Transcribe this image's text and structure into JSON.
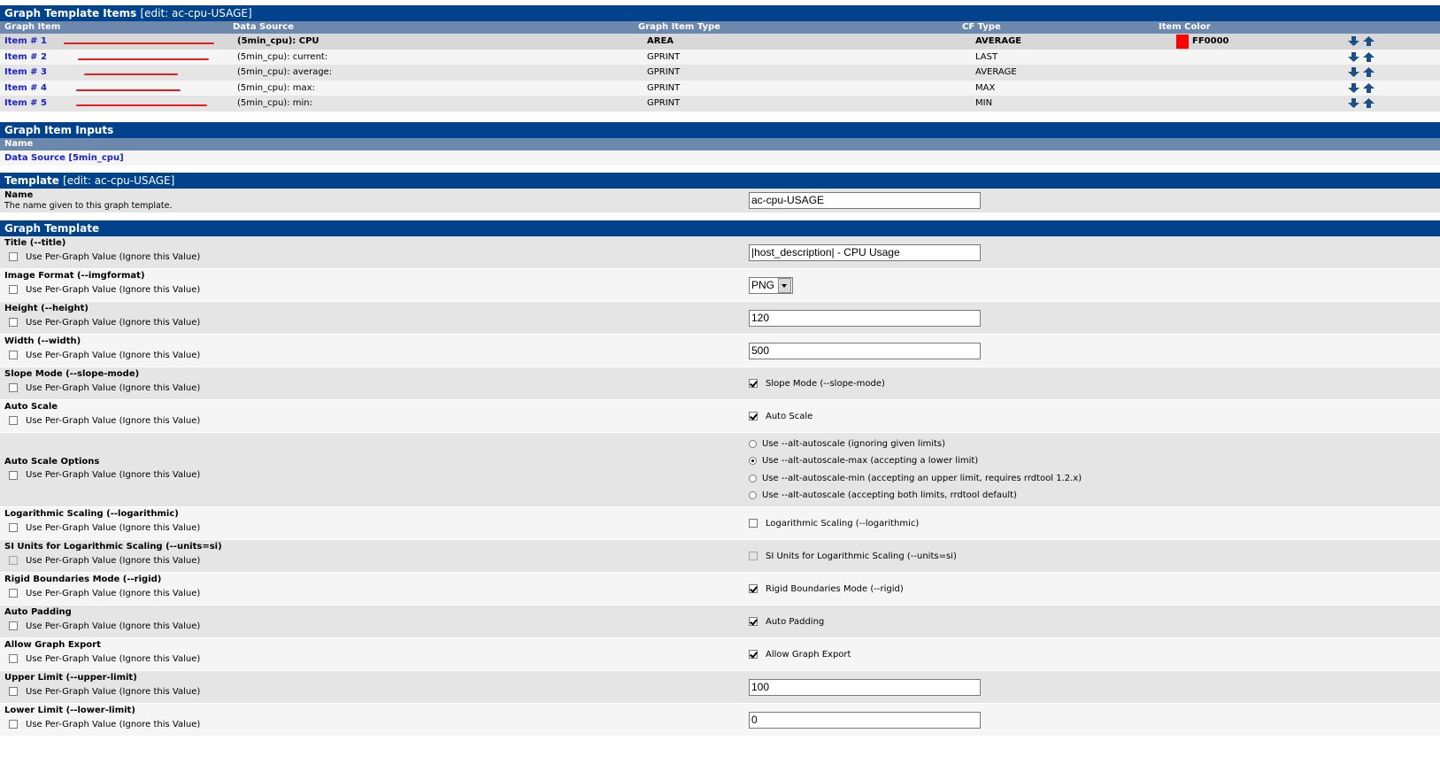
{
  "items_section": {
    "title": "Graph Template Items",
    "edit": "[edit: ac-cpu-USAGE]",
    "columns": [
      "Graph Item",
      "Data Source",
      "Graph Item Type",
      "CF Type",
      "Item Color"
    ],
    "rows": [
      {
        "item": "Item # 1",
        "source": "(5min_cpu): CPU",
        "type": "AREA",
        "cf": "AVERAGE",
        "color": "FF0000"
      },
      {
        "item": "Item # 2",
        "source": "(5min_cpu): current:",
        "type": "GPRINT",
        "cf": "LAST",
        "color": ""
      },
      {
        "item": "Item # 3",
        "source": "(5min_cpu): average:",
        "type": "GPRINT",
        "cf": "AVERAGE",
        "color": ""
      },
      {
        "item": "Item # 4",
        "source": "(5min_cpu): max:",
        "type": "GPRINT",
        "cf": "MAX",
        "color": ""
      },
      {
        "item": "Item # 5",
        "source": "(5min_cpu): min:",
        "type": "GPRINT",
        "cf": "MIN",
        "color": ""
      }
    ],
    "swatch_color": "#ff0000",
    "move_down_icon": "arrow-down-icon",
    "move_up_icon": "arrow-up-icon"
  },
  "inputs_section": {
    "title": "Graph Item Inputs",
    "column": "Name",
    "input": "Data Source [5min_cpu]"
  },
  "template_section": {
    "title": "Template",
    "edit": "[edit: ac-cpu-USAGE]",
    "name_label": "Name",
    "name_desc": "The name given to this graph template.",
    "name_value": "ac-cpu-USAGE"
  },
  "graph_section": {
    "title": "Graph Template",
    "per_graph_label": "Use Per-Graph Value (Ignore this Value)",
    "title_label": "Title (--title)",
    "title_value": "|host_description| - CPU Usage",
    "imgformat_label": "Image Format (--imgformat)",
    "imgformat_value": "PNG",
    "height_label": "Height (--height)",
    "height_value": "120",
    "width_label": "Width (--width)",
    "width_value": "500",
    "slope_label": "Slope Mode (--slope-mode)",
    "slope_check": "Slope Mode (--slope-mode)",
    "autoscale_label": "Auto Scale",
    "autoscale_check": "Auto Scale",
    "autoscale_opts_label": "Auto Scale Options",
    "autoscale_opts": [
      "Use --alt-autoscale (ignoring given limits)",
      "Use --alt-autoscale-max (accepting a lower limit)",
      "Use --alt-autoscale-min (accepting an upper limit, requires rrdtool 1.2.x)",
      "Use --alt-autoscale (accepting both limits, rrdtool default)"
    ],
    "log_label": "Logarithmic Scaling (--logarithmic)",
    "log_check": "Logarithmic Scaling (--logarithmic)",
    "si_label": "SI Units for Logarithmic Scaling (--units=si)",
    "si_check": "SI Units for Logarithmic Scaling (--units=si)",
    "rigid_label": "Rigid Boundaries Mode (--rigid)",
    "rigid_check": "Rigid Boundaries Mode (--rigid)",
    "padding_label": "Auto Padding",
    "padding_check": "Auto Padding",
    "export_label": "Allow Graph Export",
    "export_check": "Allow Graph Export",
    "upper_label": "Upper Limit (--upper-limit)",
    "upper_value": "100",
    "lower_label": "Lower Limit (--lower-limit)",
    "lower_value": "0"
  }
}
